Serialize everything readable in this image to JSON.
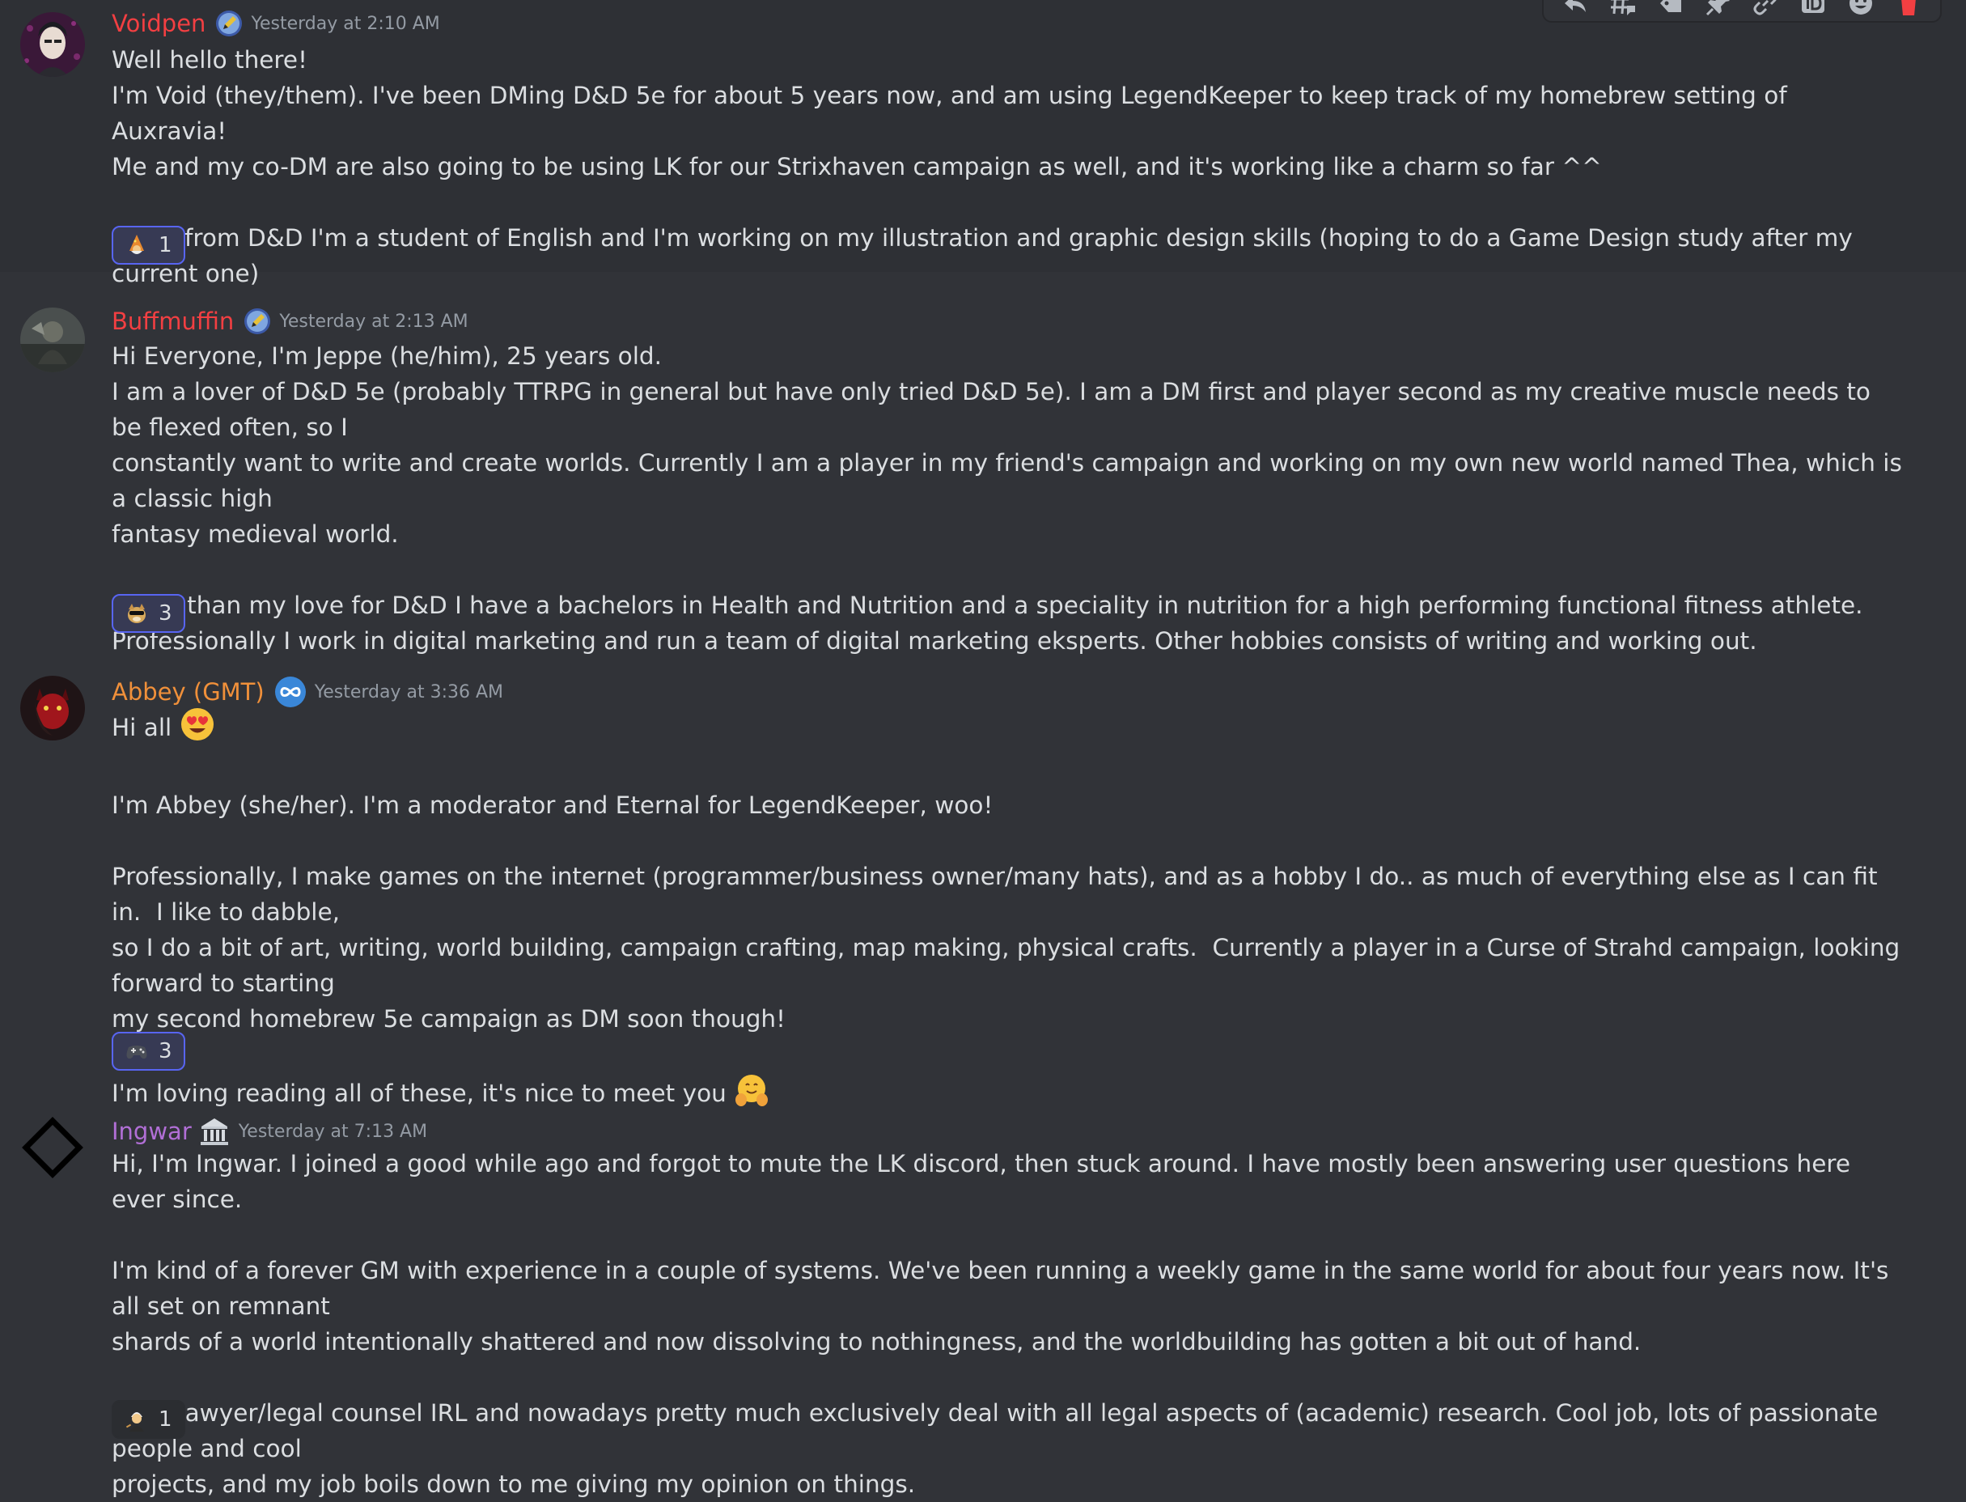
{
  "toolbar": {
    "buttons": [
      "reply-icon",
      "create-thread-icon",
      "tag-icon",
      "pin-icon",
      "link-icon",
      "id-icon",
      "add-reaction-icon",
      "delete-icon"
    ],
    "delete_color": "#f23f42"
  },
  "messages": [
    {
      "username": "Voidpen",
      "name_color": "#f23f42",
      "role_icon": "pencil-badge-icon",
      "timestamp": "Yesterday at 2:10 AM",
      "lines": [
        "Well hello there!",
        "I'm Void (they/them). I've been DMing D&D 5e for about 5 years now, and am using LegendKeeper to keep track of my homebrew setting of Auxravia!",
        "Me and my co-DM are also going to be using LK for our Strixhaven campaign as well, and it's working like a charm so far ^^",
        "",
        "Aside from D&D I'm a student of English and I'm working on my illustration and graphic design skills (hoping to do a Game Design study after my current one)"
      ],
      "reaction": {
        "emoji": "wizard-emoji",
        "count": "1"
      }
    },
    {
      "username": "Buffmuffin",
      "name_color": "#f23f42",
      "role_icon": "pencil-badge-icon",
      "timestamp": "Yesterday at 2:13 AM",
      "lines": [
        "Hi Everyone, I'm Jeppe (he/him), 25 years old.",
        "I am a lover of D&D 5e (probably TTRPG in general but have only tried D&D 5e). I am a DM first and player second as my creative muscle needs to be flexed often, so I",
        "constantly want to write and create worlds. Currently I am a player in my friend's campaign and working on my own new world named Thea, which is a classic high",
        "fantasy medieval world.",
        "",
        "Other than my love for D&D I have a bachelors in Health and Nutrition and a speciality in nutrition for a high performing functional fitness athlete.",
        "Professionally I work in digital marketing and run a team of digital marketing eksperts. Other hobbies consists of writing and working out."
      ],
      "reaction": {
        "emoji": "cool-doge-emoji",
        "count": "3"
      }
    },
    {
      "username": "Abbey (GMT)",
      "name_color": "#f0903a",
      "role_icon": "infinity-badge-icon",
      "timestamp": "Yesterday at 3:36 AM",
      "first_line": "Hi all",
      "first_line_emoji": "heart-eyes-emoji",
      "lines": [
        "",
        "I'm Abbey (she/her). I'm a moderator and Eternal for LegendKeeper, woo!",
        "",
        "Professionally, I make games on the internet (programmer/business owner/many hats), and as a hobby I do.. as much of everything else as I can fit in.  I like to dabble,",
        "so I do a bit of art, writing, world building, campaign crafting, map making, physical crafts.  Currently a player in a Curse of Strahd campaign, looking forward to starting",
        "my second homebrew 5e campaign as DM soon though!",
        ""
      ],
      "last_line": "I'm loving reading all of these, it's nice to meet you",
      "last_line_emoji": "hugging-face-emoji",
      "reaction": {
        "emoji": "game-controller-emoji",
        "count": "3"
      }
    },
    {
      "username": "Ingwar",
      "name_color": "#b16fd6",
      "role_icon": "classical-building-icon",
      "timestamp": "Yesterday at 7:13 AM",
      "lines": [
        "Hi, I'm Ingwar. I joined a good while ago and forgot to mute the LK discord, then stuck around. I have mostly been answering user questions here ever since.",
        "",
        "I'm kind of a forever GM with experience in a couple of systems. We've been running a weekly game in the same world for about four years now. It's all set on remnant",
        "shards of a world intentionally shattered and now dissolving to nothingness, and the worldbuilding has gotten a bit out of hand.",
        "",
        "I'm a lawyer/legal counsel IRL and nowadays pretty much exclusively deal with all legal aspects of (academic) research. Cool job, lots of passionate people and cool",
        "projects, and my job boils down to me giving my opinion on things."
      ],
      "reaction": {
        "emoji": "judge-emoji",
        "count": "1"
      }
    }
  ]
}
